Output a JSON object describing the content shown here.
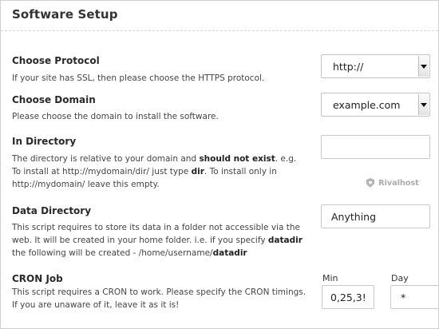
{
  "header": {
    "title": "Software Setup"
  },
  "protocol": {
    "label": "Choose Protocol",
    "description": "If your site has SSL, then please choose the HTTPS protocol.",
    "value": "http://"
  },
  "domain": {
    "label": "Choose Domain",
    "description": "Please choose the domain to install the software.",
    "value": "example.com"
  },
  "directory": {
    "label": "In Directory",
    "desc_1": "The directory is relative to your domain and ",
    "desc_bold_1": "should not exist",
    "desc_2": ". e.g. To install at http://mydomain/dir/ just type ",
    "desc_bold_2": "dir",
    "desc_3": ". To install only in http://mydomain/ leave this empty.",
    "value": ""
  },
  "watermark": {
    "text": "Rivalhost"
  },
  "data_directory": {
    "label": "Data Directory",
    "desc_1": "This script requires to store its data in a folder not accessible via the web. It will be created in your home folder. i.e. if you specify ",
    "desc_bold_1": "datadir",
    "desc_2": " the following will be created - /home/username/",
    "desc_bold_2": "datadir",
    "value": "Anything"
  },
  "cron": {
    "label": "CRON Job",
    "description": "This script requires a CRON to work. Please specify the CRON timings. If you are unaware of it, leave it as it is!",
    "min_label": "Min",
    "min_value": "0,25,3!",
    "day_label": "Day",
    "day_value": "*"
  }
}
